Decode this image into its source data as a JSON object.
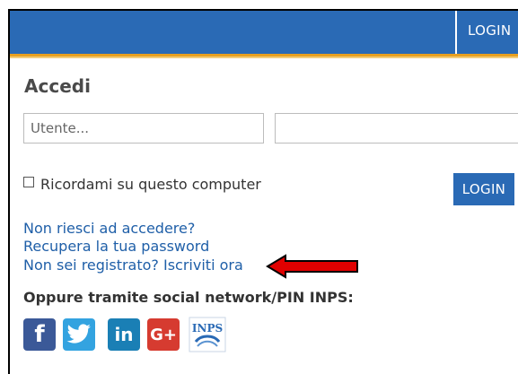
{
  "topbar": {
    "login_label": "LOGIN"
  },
  "form": {
    "title": "Accedi",
    "username_placeholder": "Utente...",
    "password_placeholder": "",
    "remember_label": "Ricordami su questo computer",
    "login_button": "LOGIN"
  },
  "links": {
    "cant_access": "Non riesci ad accedere?",
    "recover_password": "Recupera la tua password",
    "register": "Non sei registrato? Iscriviti ora"
  },
  "social": {
    "title": "Oppure tramite social network/PIN INPS:",
    "icons": [
      {
        "name": "facebook-icon",
        "glyph": "f",
        "color": "#3b5998"
      },
      {
        "name": "twitter-icon",
        "color": "#33a3e0"
      },
      {
        "name": "linkedin-icon",
        "glyph": "in",
        "color": "#1a7fb5"
      },
      {
        "name": "google-plus-icon",
        "glyph": "G+",
        "color": "#d63b30"
      },
      {
        "name": "inps-icon",
        "glyph": "INPS"
      }
    ]
  },
  "colors": {
    "brand_blue": "#2a6ab5",
    "accent_orange": "#e8a020",
    "link_blue": "#1f5fa8",
    "arrow_red": "#e00000"
  }
}
